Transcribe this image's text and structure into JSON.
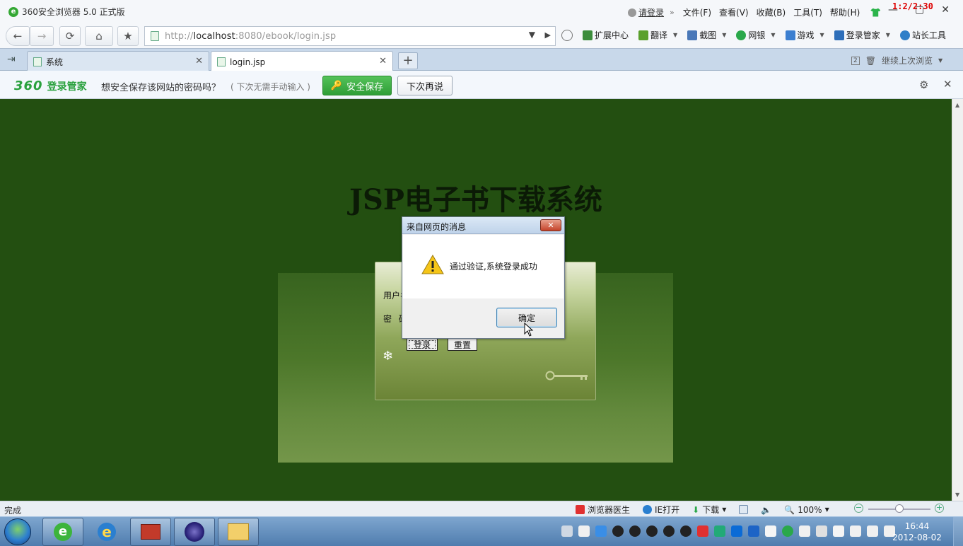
{
  "window": {
    "app_title": "360安全浏览器 5.0 正式版",
    "logo_letter": "e",
    "login_link": "请登录",
    "sep": "»",
    "menus": [
      "文件(F)",
      "查看(V)",
      "收藏(B)",
      "工具(T)",
      "帮助(H)"
    ],
    "time_overlay": "1:2/2:30",
    "minimize": "—",
    "maximize": "▢",
    "close": "✕"
  },
  "navbar": {
    "url_prefix": "http://",
    "url_host": "localhost",
    "url_rest": ":8080/ebook/login.jsp",
    "tools": [
      {
        "label": "扩展中心",
        "color": "#3c8d3c"
      },
      {
        "label": "翻译",
        "color": "#5aa02c"
      },
      {
        "label": "截图",
        "color": "#4a78b8"
      },
      {
        "label": "网银",
        "color": "#2aa84a"
      },
      {
        "label": "游戏",
        "color": "#3c7fd0"
      },
      {
        "label": "登录管家",
        "color": "#2e6fba"
      },
      {
        "label": "站长工具",
        "color": "#2f7fc8"
      }
    ]
  },
  "tabs": {
    "inactive_label": "系统",
    "active_label": "login.jsp",
    "new_tab": "+",
    "restore_count": "2",
    "restore_label": "继续上次浏览"
  },
  "password_bar": {
    "brand_360": "360",
    "brand_name": "登录管家",
    "question": "想安全保存该网站的密码吗？",
    "note": "( 下次无需手动输入 )",
    "save_label": "安全保存",
    "later_label": "下次再说"
  },
  "page": {
    "title": "JSP电子书下载系统",
    "user_label": "用户名",
    "pass_label": "密码",
    "login_button": "登录",
    "reset_button": "重置"
  },
  "dialog": {
    "title": "来自网页的消息",
    "message": "通过验证,系统登录成功",
    "ok_label": "确定"
  },
  "statusbar": {
    "status": "完成",
    "doctor": "浏览器医生",
    "ie_open": "IE打开",
    "download": "下载",
    "zoom": "100%"
  },
  "taskbar": {
    "time": "16:44",
    "date": "2012-08-02",
    "tray_colors": [
      "#cfd8e3",
      "#f0f0f0",
      "#3a8ee6",
      "#222",
      "#222",
      "#222",
      "#222",
      "#222",
      "#e03030",
      "#2a7",
      "#0b6bd6",
      "#1d64c6",
      "#f5f5f5",
      "#2aa84a",
      "#f0f0f0",
      "#e0e0e0",
      "#f5f5f5",
      "#f0f0f0",
      "#f0f0f0",
      "#f0f0f0"
    ]
  }
}
